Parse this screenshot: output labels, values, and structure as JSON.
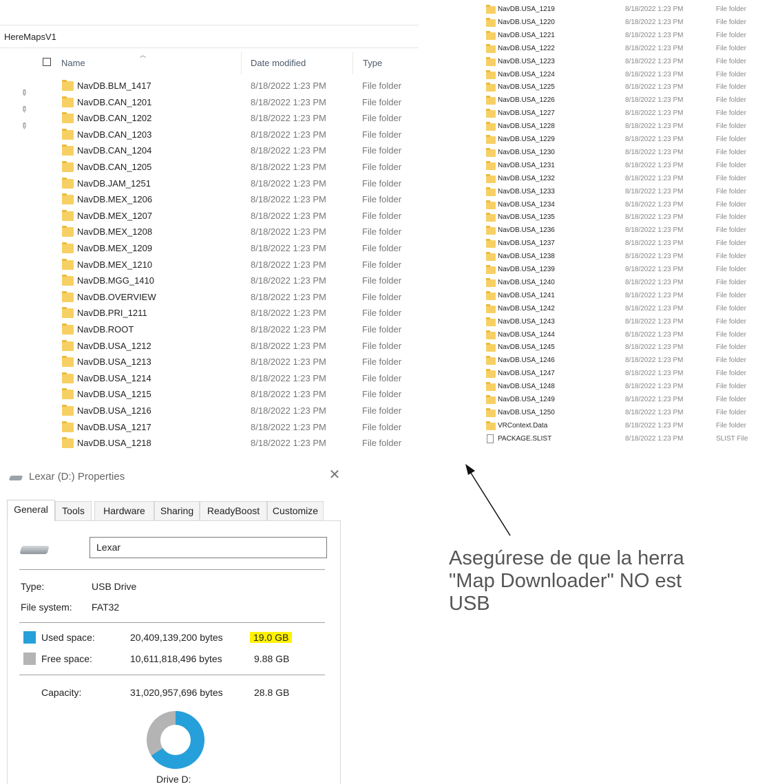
{
  "explorer_left": {
    "breadcrumb": "HereMapsV1",
    "columns": {
      "name": "Name",
      "date_modified": "Date modified",
      "type": "Type"
    },
    "rows": [
      {
        "name": "NavDB.BLM_1417",
        "date": "8/18/2022 1:23 PM",
        "type": "File folder"
      },
      {
        "name": "NavDB.CAN_1201",
        "date": "8/18/2022 1:23 PM",
        "type": "File folder"
      },
      {
        "name": "NavDB.CAN_1202",
        "date": "8/18/2022 1:23 PM",
        "type": "File folder"
      },
      {
        "name": "NavDB.CAN_1203",
        "date": "8/18/2022 1:23 PM",
        "type": "File folder"
      },
      {
        "name": "NavDB.CAN_1204",
        "date": "8/18/2022 1:23 PM",
        "type": "File folder"
      },
      {
        "name": "NavDB.CAN_1205",
        "date": "8/18/2022 1:23 PM",
        "type": "File folder"
      },
      {
        "name": "NavDB.JAM_1251",
        "date": "8/18/2022 1:23 PM",
        "type": "File folder"
      },
      {
        "name": "NavDB.MEX_1206",
        "date": "8/18/2022 1:23 PM",
        "type": "File folder"
      },
      {
        "name": "NavDB.MEX_1207",
        "date": "8/18/2022 1:23 PM",
        "type": "File folder"
      },
      {
        "name": "NavDB.MEX_1208",
        "date": "8/18/2022 1:23 PM",
        "type": "File folder"
      },
      {
        "name": "NavDB.MEX_1209",
        "date": "8/18/2022 1:23 PM",
        "type": "File folder"
      },
      {
        "name": "NavDB.MEX_1210",
        "date": "8/18/2022 1:23 PM",
        "type": "File folder"
      },
      {
        "name": "NavDB.MGG_1410",
        "date": "8/18/2022 1:23 PM",
        "type": "File folder"
      },
      {
        "name": "NavDB.OVERVIEW",
        "date": "8/18/2022 1:23 PM",
        "type": "File folder"
      },
      {
        "name": "NavDB.PRI_1211",
        "date": "8/18/2022 1:23 PM",
        "type": "File folder"
      },
      {
        "name": "NavDB.ROOT",
        "date": "8/18/2022 1:23 PM",
        "type": "File folder"
      },
      {
        "name": "NavDB.USA_1212",
        "date": "8/18/2022 1:23 PM",
        "type": "File folder"
      },
      {
        "name": "NavDB.USA_1213",
        "date": "8/18/2022 1:23 PM",
        "type": "File folder"
      },
      {
        "name": "NavDB.USA_1214",
        "date": "8/18/2022 1:23 PM",
        "type": "File folder"
      },
      {
        "name": "NavDB.USA_1215",
        "date": "8/18/2022 1:23 PM",
        "type": "File folder"
      },
      {
        "name": "NavDB.USA_1216",
        "date": "8/18/2022 1:23 PM",
        "type": "File folder"
      },
      {
        "name": "NavDB.USA_1217",
        "date": "8/18/2022 1:23 PM",
        "type": "File folder"
      },
      {
        "name": "NavDB.USA_1218",
        "date": "8/18/2022 1:23 PM",
        "type": "File folder"
      }
    ]
  },
  "explorer_right": {
    "rows": [
      {
        "name": "NavDB.USA_1219",
        "date": "8/18/2022 1:23 PM",
        "type": "File folder",
        "icon": "folder-icon"
      },
      {
        "name": "NavDB.USA_1220",
        "date": "8/18/2022 1:23 PM",
        "type": "File folder",
        "icon": "folder-icon"
      },
      {
        "name": "NavDB.USA_1221",
        "date": "8/18/2022 1:23 PM",
        "type": "File folder",
        "icon": "folder-icon"
      },
      {
        "name": "NavDB.USA_1222",
        "date": "8/18/2022 1:23 PM",
        "type": "File folder",
        "icon": "folder-icon"
      },
      {
        "name": "NavDB.USA_1223",
        "date": "8/18/2022 1:23 PM",
        "type": "File folder",
        "icon": "folder-icon"
      },
      {
        "name": "NavDB.USA_1224",
        "date": "8/18/2022 1:23 PM",
        "type": "File folder",
        "icon": "folder-icon"
      },
      {
        "name": "NavDB.USA_1225",
        "date": "8/18/2022 1:23 PM",
        "type": "File folder",
        "icon": "folder-icon"
      },
      {
        "name": "NavDB.USA_1226",
        "date": "8/18/2022 1:23 PM",
        "type": "File folder",
        "icon": "folder-icon"
      },
      {
        "name": "NavDB.USA_1227",
        "date": "8/18/2022 1:23 PM",
        "type": "File folder",
        "icon": "folder-icon"
      },
      {
        "name": "NavDB.USA_1228",
        "date": "8/18/2022 1:23 PM",
        "type": "File folder",
        "icon": "folder-icon"
      },
      {
        "name": "NavDB.USA_1229",
        "date": "8/18/2022 1:23 PM",
        "type": "File folder",
        "icon": "folder-icon"
      },
      {
        "name": "NavDB.USA_1230",
        "date": "8/18/2022 1:23 PM",
        "type": "File folder",
        "icon": "folder-icon"
      },
      {
        "name": "NavDB.USA_1231",
        "date": "8/18/2022 1:23 PM",
        "type": "File folder",
        "icon": "folder-icon"
      },
      {
        "name": "NavDB.USA_1232",
        "date": "8/18/2022 1:23 PM",
        "type": "File folder",
        "icon": "folder-icon"
      },
      {
        "name": "NavDB.USA_1233",
        "date": "8/18/2022 1:23 PM",
        "type": "File folder",
        "icon": "folder-icon"
      },
      {
        "name": "NavDB.USA_1234",
        "date": "8/18/2022 1:23 PM",
        "type": "File folder",
        "icon": "folder-icon"
      },
      {
        "name": "NavDB.USA_1235",
        "date": "8/18/2022 1:23 PM",
        "type": "File folder",
        "icon": "folder-icon"
      },
      {
        "name": "NavDB.USA_1236",
        "date": "8/18/2022 1:23 PM",
        "type": "File folder",
        "icon": "folder-icon"
      },
      {
        "name": "NavDB.USA_1237",
        "date": "8/18/2022 1:23 PM",
        "type": "File folder",
        "icon": "folder-icon"
      },
      {
        "name": "NavDB.USA_1238",
        "date": "8/18/2022 1:23 PM",
        "type": "File folder",
        "icon": "folder-icon"
      },
      {
        "name": "NavDB.USA_1239",
        "date": "8/18/2022 1:23 PM",
        "type": "File folder",
        "icon": "folder-icon"
      },
      {
        "name": "NavDB.USA_1240",
        "date": "8/18/2022 1:23 PM",
        "type": "File folder",
        "icon": "folder-icon"
      },
      {
        "name": "NavDB.USA_1241",
        "date": "8/18/2022 1:23 PM",
        "type": "File folder",
        "icon": "folder-icon"
      },
      {
        "name": "NavDB.USA_1242",
        "date": "8/18/2022 1:23 PM",
        "type": "File folder",
        "icon": "folder-icon"
      },
      {
        "name": "NavDB.USA_1243",
        "date": "8/18/2022 1:23 PM",
        "type": "File folder",
        "icon": "folder-icon"
      },
      {
        "name": "NavDB.USA_1244",
        "date": "8/18/2022 1:23 PM",
        "type": "File folder",
        "icon": "folder-icon"
      },
      {
        "name": "NavDB.USA_1245",
        "date": "8/18/2022 1:23 PM",
        "type": "File folder",
        "icon": "folder-icon"
      },
      {
        "name": "NavDB.USA_1246",
        "date": "8/18/2022 1:23 PM",
        "type": "File folder",
        "icon": "folder-icon"
      },
      {
        "name": "NavDB.USA_1247",
        "date": "8/18/2022 1:23 PM",
        "type": "File folder",
        "icon": "folder-icon"
      },
      {
        "name": "NavDB.USA_1248",
        "date": "8/18/2022 1:23 PM",
        "type": "File folder",
        "icon": "folder-icon"
      },
      {
        "name": "NavDB.USA_1249",
        "date": "8/18/2022 1:23 PM",
        "type": "File folder",
        "icon": "folder-icon"
      },
      {
        "name": "NavDB.USA_1250",
        "date": "8/18/2022 1:23 PM",
        "type": "File folder",
        "icon": "folder-icon"
      },
      {
        "name": "VRContext.Data",
        "date": "8/18/2022 1:23 PM",
        "type": "File folder",
        "icon": "folder-icon"
      },
      {
        "name": "PACKAGE.SLIST",
        "date": "8/18/2022 1:23 PM",
        "type": "SLIST File",
        "icon": "file-icon"
      }
    ]
  },
  "properties": {
    "title": "Lexar (D:) Properties",
    "close_glyph": "✕",
    "tabs": [
      "General",
      "Tools",
      "Hardware",
      "Sharing",
      "ReadyBoost",
      "Customize"
    ],
    "active_tab": "General",
    "drive_name": "Lexar",
    "type_label": "Type:",
    "type_value": "USB Drive",
    "fs_label": "File system:",
    "fs_value": "FAT32",
    "used_label": "Used space:",
    "used_bytes": "20,409,139,200 bytes",
    "used_gb": "19.0 GB",
    "free_label": "Free space:",
    "free_bytes": "10,611,818,496 bytes",
    "free_gb": "9.88 GB",
    "capacity_label": "Capacity:",
    "capacity_bytes": "31,020,957,696 bytes",
    "capacity_gb": "28.8 GB",
    "drive_caption": "Drive D:",
    "used_fraction": 0.658,
    "colors": {
      "used": "#26a0da",
      "free": "#b4b4b4",
      "highlight": "#fff200"
    }
  },
  "annotation": {
    "line1": "Asegúrese de que la herra",
    "line2": "\"Map Downloader\" NO est",
    "line3": "USB"
  }
}
